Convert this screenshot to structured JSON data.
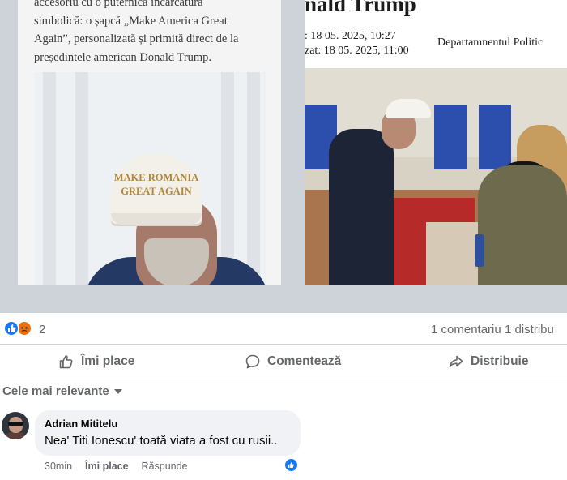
{
  "post": {
    "left_article": {
      "snippet_lines": [
        "accesoriu cu o puternică încărcătură",
        "simbolică: o șapcă „Make America Great",
        "Again”, personalizată și primită direct de la",
        "președintele american Donald Trump."
      ],
      "cap_lines": [
        "MAKE ROMANIA",
        "GREAT AGAIN"
      ]
    },
    "right_article": {
      "headline": "nald Trump",
      "date_lines": [
        ": 18 05. 2025, 10:27",
        "zat: 18 05. 2025, 11:00"
      ],
      "department": "Departamnentul Politic"
    }
  },
  "reactions": {
    "count": "2",
    "comments": "1 comentariu",
    "shares": "1 distribu"
  },
  "actions": {
    "like": "Îmi place",
    "comment": "Comentează",
    "share": "Distribuie"
  },
  "comments_section": {
    "sort_label": "Cele mai relevante",
    "items": [
      {
        "author": "Adrian Mititelu",
        "text": "Nea' Titi Ionescu' toată viata a fost cu rusii..",
        "time": "30min",
        "like_label": "Îmi place",
        "reply_label": "Răspunde"
      }
    ]
  },
  "colors": {
    "accent": "#1877f2",
    "secondary_text": "#65676b",
    "bubble": "#f0f2f5",
    "angry": "#e9710f"
  }
}
